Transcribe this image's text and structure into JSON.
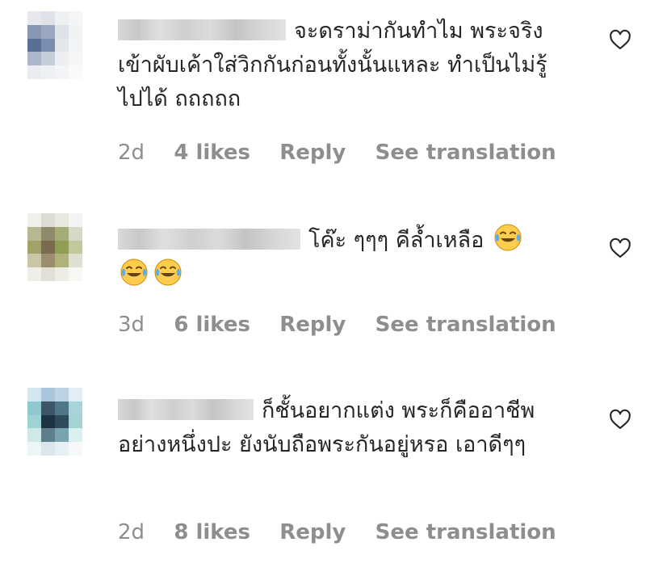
{
  "comments": [
    {
      "text": "จะดราม่ากันทำไม พระจริงเข้าผับเค้าใส่วิกกันก่อนทั้งนั้นแหละ ทำเป็นไม่รู้ไปได้ ถถถถถ",
      "time": "2d",
      "likes": "4 likes",
      "reply": "Reply",
      "translate": "See translation"
    },
    {
      "text": "โค๊ะ ๆๆๆ คีล้ำเหลือ",
      "emoji_count": 3,
      "time": "3d",
      "likes": "6 likes",
      "reply": "Reply",
      "translate": "See translation"
    },
    {
      "text": "ก็ชั้นอยากแต่ง พระก็คืออาชีพอย่างหนึ่งปะ ยังนับถือพระกันอยู่หรอ เอาดีๆๆ",
      "time": "2d",
      "likes": "8 likes",
      "reply": "Reply",
      "translate": "See translation"
    }
  ],
  "icons": {
    "like": "heart-outline-icon",
    "emoji": "face-with-tears-of-joy-emoji"
  },
  "colors": {
    "text": "#262626",
    "meta": "#8e8e8e",
    "background": "#ffffff"
  }
}
